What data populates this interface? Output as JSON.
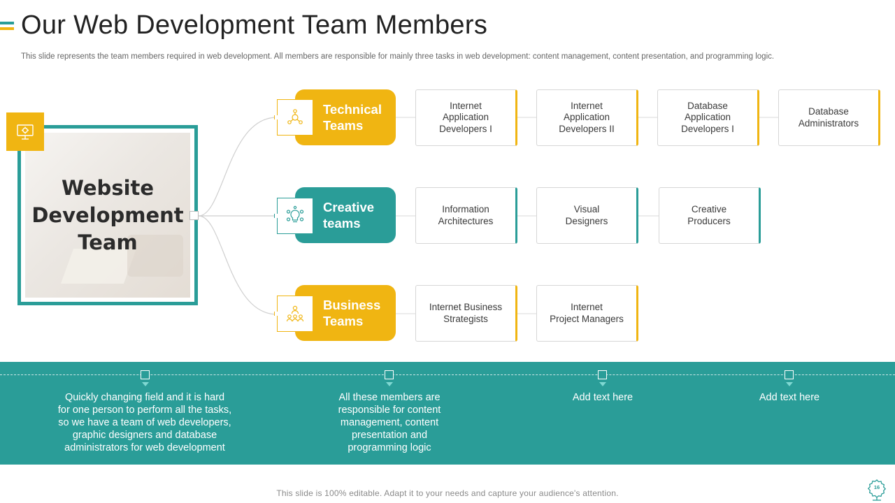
{
  "title": "Our Web Development Team Members",
  "subtitle": "This slide represents the team members required in web development. All members are responsible for mainly three tasks in web development: content management, content presentation, and programming logic.",
  "hero": {
    "label": "Website\nDevelopment\nTeam",
    "icon": "monitor-gear-icon"
  },
  "teams": [
    {
      "label": "Technical\nTeams",
      "color": "#f0b512",
      "icon": "network-people-icon",
      "members": [
        "Internet\nApplication\nDevelopers I",
        "Internet\nApplication\nDevelopers II",
        "Database\nApplication\nDevelopers I",
        "Database\nAdministrators"
      ]
    },
    {
      "label": "Creative\nteams",
      "color": "#2a9d98",
      "icon": "lightbulb-idea-icon",
      "members": [
        "Information\nArchitectures",
        "Visual\nDesigners",
        "Creative\nProducers"
      ]
    },
    {
      "label": "Business\nTeams",
      "color": "#f0b512",
      "icon": "team-hierarchy-icon",
      "members": [
        "Internet Business\nStrategists",
        "Internet\nProject Managers"
      ]
    }
  ],
  "band": {
    "notes": [
      "Quickly changing field and it is hard\nfor one person to perform all the tasks,\nso we have a team of web developers,\ngraphic designers and database\nadministrators for web development",
      "All these members are\nresponsible for content\nmanagement, content\npresentation and\nprogramming logic",
      "Add text here",
      "Add text here"
    ]
  },
  "footer": "This slide is 100% editable. Adapt it to your needs and capture your audience's attention.",
  "page_number": "16",
  "colors": {
    "teal": "#2a9d98",
    "yellow": "#f0b512"
  }
}
